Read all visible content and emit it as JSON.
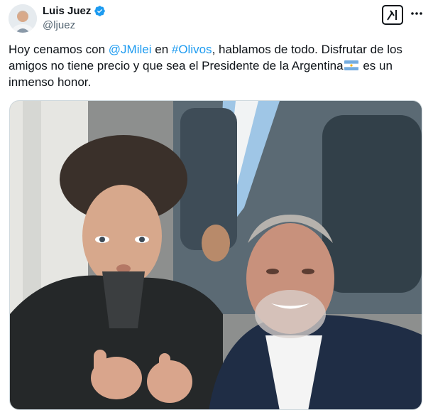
{
  "author": {
    "display_name": "Luis Juez",
    "handle": "@ljuez",
    "verified": true,
    "avatar_icon": "person-avatar-icon"
  },
  "actions": {
    "grok_icon": "grok-icon",
    "more_icon": "more-dots-icon"
  },
  "tweet": {
    "text_segments": {
      "s1": "Hoy cenamos con ",
      "mention": "@JMilei",
      "s2": " en ",
      "hashtag": "#Olivos",
      "s3": ", hablamos de todo. Disfrutar de los",
      "line2": "amigos no tiene precio y que sea el Presidente de la Argentina",
      "flag_icon": "argentina-flag-icon",
      "s4": " es un",
      "line3": "inmenso honor."
    }
  },
  "media": {
    "type": "photo"
  },
  "colors": {
    "link": "#1d9bf0",
    "verified": "#1d9bf0",
    "text": "#0f1419",
    "secondary": "#536471"
  }
}
